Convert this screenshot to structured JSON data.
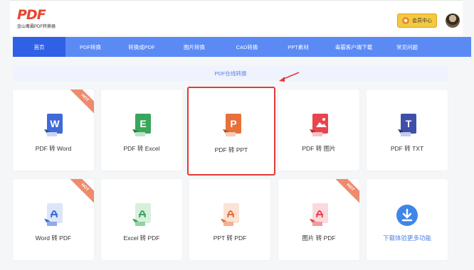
{
  "header": {
    "logo_text": "PDF",
    "logo_sub": "金山毒霸PDF转换器",
    "vip_label": "会员中心"
  },
  "nav": {
    "items": [
      {
        "label": "首页",
        "active": true
      },
      {
        "label": "PDF转换",
        "active": false
      },
      {
        "label": "转换成PDF",
        "active": false
      },
      {
        "label": "图片转换",
        "active": false
      },
      {
        "label": "CAD转换",
        "active": false
      },
      {
        "label": "PPT素材",
        "active": false
      },
      {
        "label": "毒霸客户端下载",
        "active": false
      },
      {
        "label": "常见问题",
        "active": false
      }
    ]
  },
  "section": {
    "title": "PDF在线转换"
  },
  "cards": [
    {
      "label": "PDF 转 Word",
      "icon": "word-icon",
      "hot": "HOT",
      "color": "#3f6ad6",
      "letter": "W"
    },
    {
      "label": "PDF 转 Excel",
      "icon": "excel-icon",
      "hot": "",
      "color": "#3aa65b",
      "letter": "E"
    },
    {
      "label": "PDF 转 PPT",
      "icon": "ppt-icon",
      "hot": "",
      "color": "#e8703a",
      "letter": "P",
      "highlight": true
    },
    {
      "label": "PDF 转 图片",
      "icon": "image-icon",
      "hot": "",
      "color": "#e8454f",
      "letter": ""
    },
    {
      "label": "PDF 转 TXT",
      "icon": "txt-icon",
      "hot": "",
      "color": "#3f4fa8",
      "letter": "T"
    },
    {
      "label": "Word 转 PDF",
      "icon": "word-to-pdf-icon",
      "hot": "HOT",
      "color": "#3f6ad6",
      "letter": ""
    },
    {
      "label": "Excel 转 PDF",
      "icon": "excel-to-pdf-icon",
      "hot": "",
      "color": "#3aa65b",
      "letter": ""
    },
    {
      "label": "PPT 转 PDF",
      "icon": "ppt-to-pdf-icon",
      "hot": "",
      "color": "#e8703a",
      "letter": ""
    },
    {
      "label": "图片 转 PDF",
      "icon": "image-to-pdf-icon",
      "hot": "HOT",
      "color": "#e8454f",
      "letter": ""
    },
    {
      "label": "下载体验更多功能",
      "icon": "download-icon",
      "hot": "",
      "color": "#3f86e8",
      "letter": ""
    }
  ]
}
